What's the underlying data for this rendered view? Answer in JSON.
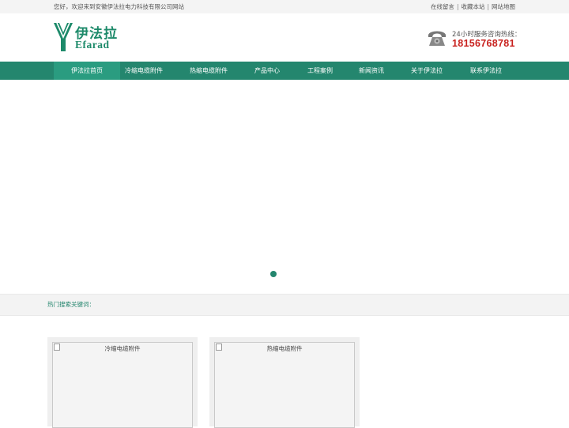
{
  "topbar": {
    "welcome": "您好，欢迎来到安徽伊法拉电力科技有限公司网站",
    "links": [
      "在线留言",
      "收藏本站",
      "网站地图"
    ],
    "separator": "|"
  },
  "logo": {
    "name_cn": "伊法拉",
    "name_en": "Efarad"
  },
  "hotline": {
    "label": "24小时服务咨询热线：",
    "number": "18156768781"
  },
  "nav": [
    "伊法拉首页",
    "冷缩电缆附件",
    "热缩电缆附件",
    "产品中心",
    "工程案例",
    "新闻资讯",
    "关于伊法拉",
    "联系伊法拉"
  ],
  "search": {
    "keywords_label": "热门搜索关键词："
  },
  "products": [
    {
      "alt": "冷缩电缆附件"
    },
    {
      "alt": "热缩电缆附件"
    }
  ],
  "colors": {
    "brand_green": "#24866e",
    "hotline_red": "#c8211e"
  }
}
